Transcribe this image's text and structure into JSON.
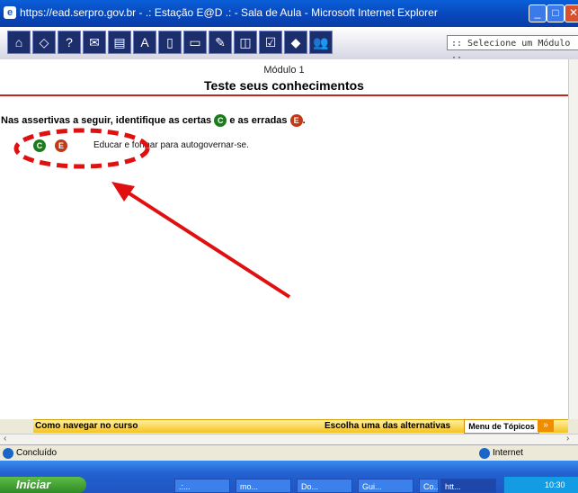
{
  "window": {
    "title": "https://ead.serpro.gov.br - .: Estação E@D .: - Sala de Aula - Microsoft Internet Explorer",
    "min": "_",
    "max": "□",
    "close": "✕"
  },
  "toolbar": {
    "icons": [
      "home-icon",
      "bookmark-icon",
      "help-icon",
      "mail-icon",
      "print-icon",
      "glossary-icon",
      "page-icon",
      "library-icon",
      "edit-icon",
      "notes-icon",
      "checklist-icon",
      "forum-icon",
      "group-icon"
    ],
    "glyphs": [
      "⌂",
      "◇",
      "?",
      "✉",
      "▤",
      "A",
      "▯",
      "▭",
      "✎",
      "◫",
      "☑",
      "◆",
      "👥"
    ],
    "module_select": ":: Selecione um Módulo ::"
  },
  "page": {
    "module": "Módulo 1",
    "heading": "Teste seus conhecimentos",
    "instr_pre": "Nas assertivas a seguir, identifique as certas",
    "instr_mid": "e as erradas",
    "instr_end": ".",
    "c_letter": "C",
    "e_letter": "E",
    "statement": "Educar e formar para autogovernar-se."
  },
  "bottom": {
    "nav": "Como navegar no curso",
    "alternatives": "Escolha uma das alternativas",
    "topics": "Menu de Tópicos",
    "arrows": "»"
  },
  "statusbar": {
    "left": "Concluído",
    "zone": "Internet"
  },
  "taskbar": {
    "start": "Iniciar",
    "tasks": [
      ".:...",
      "mo...",
      "Do...",
      "Gui...",
      "Co...",
      "htt..."
    ],
    "clock": "10:30"
  },
  "colors": {
    "accent_red": "#e01010",
    "correct": "#1e7a1e",
    "wrong": "#c03a18"
  }
}
